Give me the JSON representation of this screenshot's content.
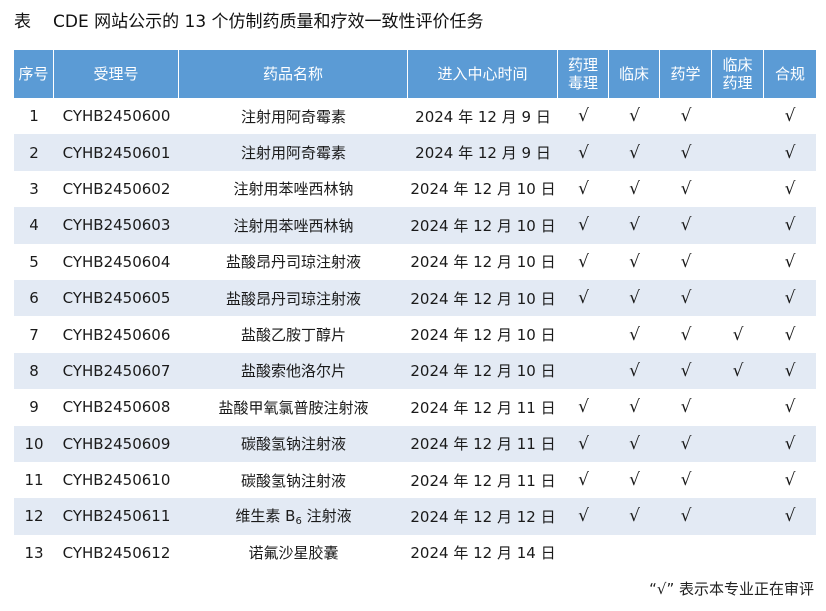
{
  "caption": {
    "label": "表",
    "title": "CDE 网站公示的 13 个仿制药质量和疗效一致性评价任务"
  },
  "columns": [
    "序号",
    "受理号",
    "药品名称",
    "进入中心时间",
    "药理\n毒理",
    "临床",
    "药学",
    "临床\n药理",
    "合规"
  ],
  "rows": [
    {
      "no": "1",
      "id": "CYHB2450600",
      "name": "注射用阿奇霉素",
      "date": "2024 年 12 月 9 日",
      "tox": "√",
      "clin": "√",
      "pharm": "√",
      "cp": "",
      "comp": "√"
    },
    {
      "no": "2",
      "id": "CYHB2450601",
      "name": "注射用阿奇霉素",
      "date": "2024 年 12 月 9 日",
      "tox": "√",
      "clin": "√",
      "pharm": "√",
      "cp": "",
      "comp": "√"
    },
    {
      "no": "3",
      "id": "CYHB2450602",
      "name": "注射用苯唑西林钠",
      "date": "2024 年 12 月 10 日",
      "tox": "√",
      "clin": "√",
      "pharm": "√",
      "cp": "",
      "comp": "√"
    },
    {
      "no": "4",
      "id": "CYHB2450603",
      "name": "注射用苯唑西林钠",
      "date": "2024 年 12 月 10 日",
      "tox": "√",
      "clin": "√",
      "pharm": "√",
      "cp": "",
      "comp": "√"
    },
    {
      "no": "5",
      "id": "CYHB2450604",
      "name": "盐酸昂丹司琼注射液",
      "date": "2024 年 12 月 10 日",
      "tox": "√",
      "clin": "√",
      "pharm": "√",
      "cp": "",
      "comp": "√"
    },
    {
      "no": "6",
      "id": "CYHB2450605",
      "name": "盐酸昂丹司琼注射液",
      "date": "2024 年 12 月 10 日",
      "tox": "√",
      "clin": "√",
      "pharm": "√",
      "cp": "",
      "comp": "√"
    },
    {
      "no": "7",
      "id": "CYHB2450606",
      "name": "盐酸乙胺丁醇片",
      "date": "2024 年 12 月 10 日",
      "tox": "",
      "clin": "√",
      "pharm": "√",
      "cp": "√",
      "comp": "√"
    },
    {
      "no": "8",
      "id": "CYHB2450607",
      "name": "盐酸索他洛尔片",
      "date": "2024 年 12 月 10 日",
      "tox": "",
      "clin": "√",
      "pharm": "√",
      "cp": "√",
      "comp": "√"
    },
    {
      "no": "9",
      "id": "CYHB2450608",
      "name": "盐酸甲氧氯普胺注射液",
      "date": "2024 年 12 月 11 日",
      "tox": "√",
      "clin": "√",
      "pharm": "√",
      "cp": "",
      "comp": "√"
    },
    {
      "no": "10",
      "id": "CYHB2450609",
      "name": "碳酸氢钠注射液",
      "date": "2024 年 12 月 11 日",
      "tox": "√",
      "clin": "√",
      "pharm": "√",
      "cp": "",
      "comp": "√"
    },
    {
      "no": "11",
      "id": "CYHB2450610",
      "name": "碳酸氢钠注射液",
      "date": "2024 年 12 月 11 日",
      "tox": "√",
      "clin": "√",
      "pharm": "√",
      "cp": "",
      "comp": "√"
    },
    {
      "no": "12",
      "id": "CYHB2450611",
      "name": "维生素 B",
      "name_sub": "6",
      "name_tail": " 注射液",
      "date": "2024 年 12 月 12 日",
      "tox": "√",
      "clin": "√",
      "pharm": "√",
      "cp": "",
      "comp": "√"
    },
    {
      "no": "13",
      "id": "CYHB2450612",
      "name": "诺氟沙星胶囊",
      "date": "2024 年 12 月 14 日",
      "tox": "",
      "clin": "",
      "pharm": "",
      "cp": "",
      "comp": ""
    }
  ],
  "note": "“√” 表示本专业正在审评"
}
